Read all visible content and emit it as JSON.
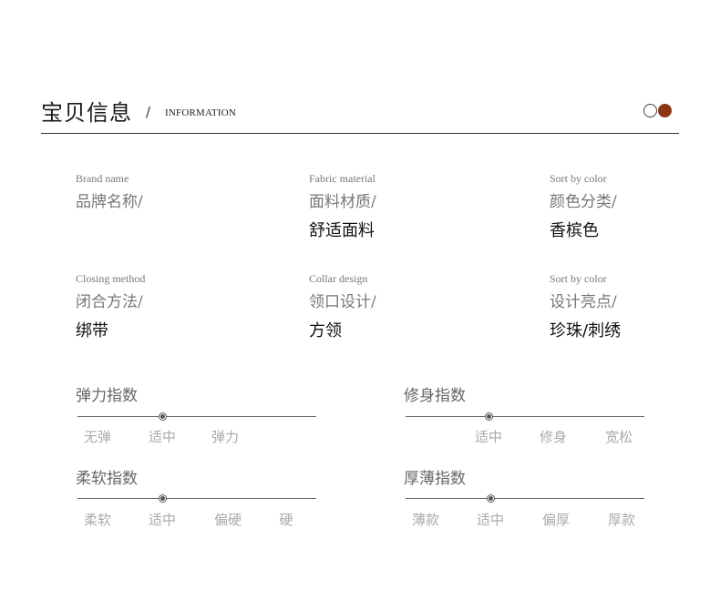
{
  "header": {
    "title": "宝贝信息",
    "slash": "/",
    "subtitle": "INFORMATION",
    "dot_colors": {
      "outline": "#444444",
      "fill": "#8c3414"
    }
  },
  "info": [
    {
      "en": "Brand name",
      "cn": "品牌名称/",
      "value": ""
    },
    {
      "en": "Fabric material",
      "cn": "面料材质/",
      "value": "舒适面料"
    },
    {
      "en": "Sort by color",
      "cn": "颜色分类/",
      "value": "香槟色"
    },
    {
      "en": "Closing method",
      "cn": "闭合方法/",
      "value": "绑带"
    },
    {
      "en": "Collar design",
      "cn": "领口设计/",
      "value": "方领"
    },
    {
      "en": "Sort by color",
      "cn": "设计亮点/",
      "value": "珍珠/刺绣"
    }
  ],
  "scales": [
    {
      "title": "弹力指数",
      "labels": [
        "无弹",
        "适中",
        "弹力"
      ],
      "selected_index": 1
    },
    {
      "title": "修身指数",
      "labels": [
        "适中",
        "修身",
        "宽松"
      ],
      "selected_index": 0
    },
    {
      "title": "柔软指数",
      "labels": [
        "柔软",
        "适中",
        "偏硬",
        "硬"
      ],
      "selected_index": 1
    },
    {
      "title": "厚薄指数",
      "labels": [
        "薄款",
        "适中",
        "偏厚",
        "厚款"
      ],
      "selected_index": 1
    }
  ]
}
